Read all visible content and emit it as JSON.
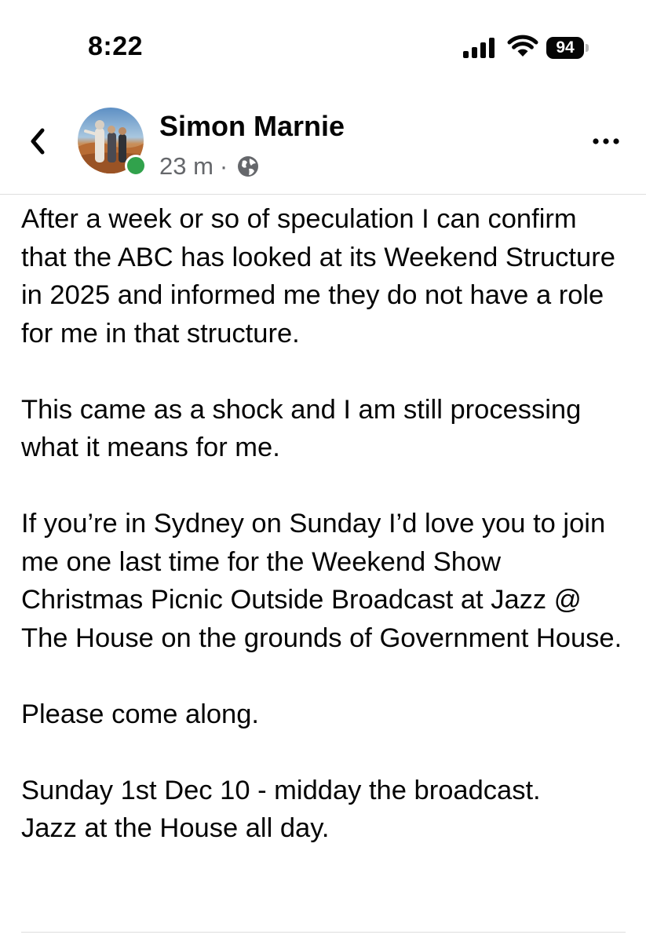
{
  "status_bar": {
    "time": "8:22",
    "battery_level": "94",
    "icons": [
      "signal-icon",
      "wifi-icon",
      "battery-icon"
    ]
  },
  "post": {
    "author": "Simon Marnie",
    "time_ago": "23 m",
    "separator": "·",
    "audience_icon": "globe-icon",
    "author_online": true,
    "paragraphs": [
      "After a week or so of speculation I can confirm that the ABC has looked at its Weekend Structure in 2025 and informed me they do not have a role for me in that structure.",
      "This came as a shock and I am still processing what it means for me.",
      "If you’re in Sydney on Sunday I’d love you to join me one last time for the Weekend Show Christmas Picnic Outside Broadcast at Jazz @ The House on the grounds of Government House.",
      "Please come along.",
      "Sunday 1st Dec 10 - midday the broadcast.\nJazz at the House all day."
    ]
  },
  "colors": {
    "text": "#050505",
    "meta": "#65676b",
    "online": "#31a24c",
    "divider": "#dedede"
  }
}
